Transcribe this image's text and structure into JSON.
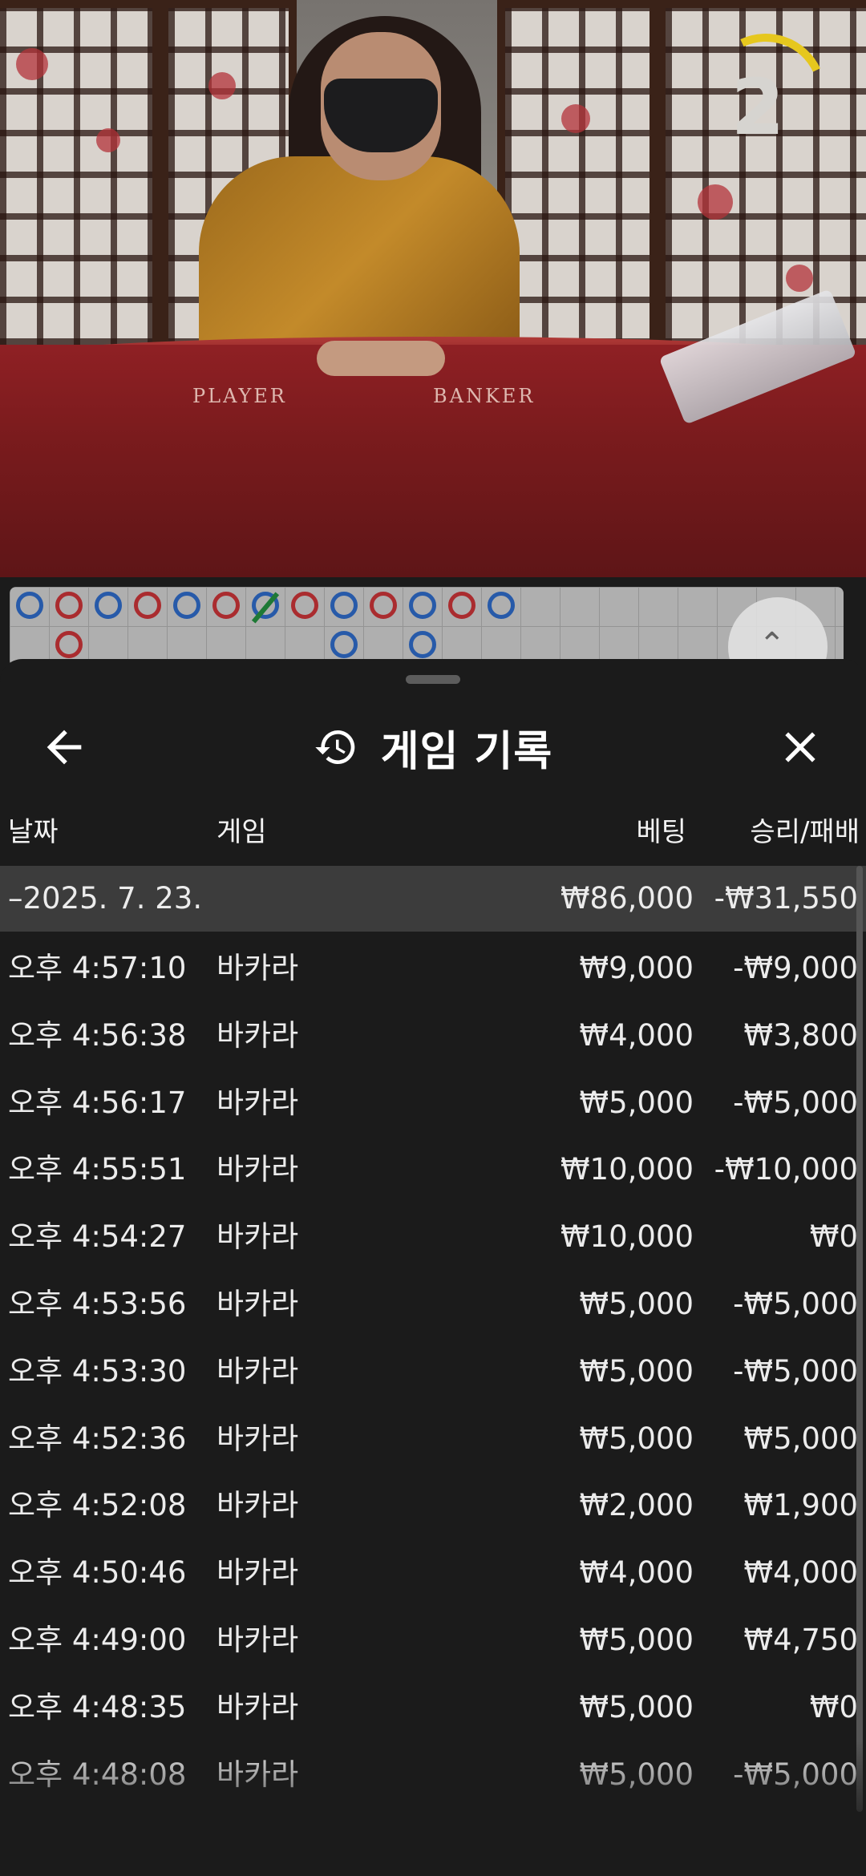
{
  "video": {
    "felt_player": "PLAYER",
    "felt_banker": "BANKER",
    "countdown": "2"
  },
  "sheet": {
    "title": "게임 기록",
    "columns": {
      "date": "날짜",
      "game": "게임",
      "bet": "베팅",
      "result": "승리/패배"
    },
    "date_group": {
      "date": "–2025. 7. 23.",
      "total_bet": "₩86,000",
      "total_result": "-₩31,550"
    },
    "rows": [
      {
        "time": "오후 4:57:10",
        "game": "바카라",
        "bet": "₩9,000",
        "result": "-₩9,000"
      },
      {
        "time": "오후 4:56:38",
        "game": "바카라",
        "bet": "₩4,000",
        "result": "₩3,800"
      },
      {
        "time": "오후 4:56:17",
        "game": "바카라",
        "bet": "₩5,000",
        "result": "-₩5,000"
      },
      {
        "time": "오후 4:55:51",
        "game": "바카라",
        "bet": "₩10,000",
        "result": "-₩10,000"
      },
      {
        "time": "오후 4:54:27",
        "game": "바카라",
        "bet": "₩10,000",
        "result": "₩0"
      },
      {
        "time": "오후 4:53:56",
        "game": "바카라",
        "bet": "₩5,000",
        "result": "-₩5,000"
      },
      {
        "time": "오후 4:53:30",
        "game": "바카라",
        "bet": "₩5,000",
        "result": "-₩5,000"
      },
      {
        "time": "오후 4:52:36",
        "game": "바카라",
        "bet": "₩5,000",
        "result": "₩5,000"
      },
      {
        "time": "오후 4:52:08",
        "game": "바카라",
        "bet": "₩2,000",
        "result": "₩1,900"
      },
      {
        "time": "오후 4:50:46",
        "game": "바카라",
        "bet": "₩4,000",
        "result": "₩4,000"
      },
      {
        "time": "오후 4:49:00",
        "game": "바카라",
        "bet": "₩5,000",
        "result": "₩4,750"
      },
      {
        "time": "오후 4:48:35",
        "game": "바카라",
        "bet": "₩5,000",
        "result": "₩0"
      },
      {
        "time": "오후 4:48:08",
        "game": "바카라",
        "bet": "₩5,000",
        "result": "-₩5,000"
      }
    ]
  },
  "icons": {
    "back": "back-arrow-icon",
    "history": "history-icon",
    "close": "close-icon",
    "expand": "chevron-up-icon"
  },
  "colors": {
    "player": "#2a66c2",
    "banker": "#c43033",
    "tie": "#1f8a3a",
    "timer": "#e6c71e"
  }
}
